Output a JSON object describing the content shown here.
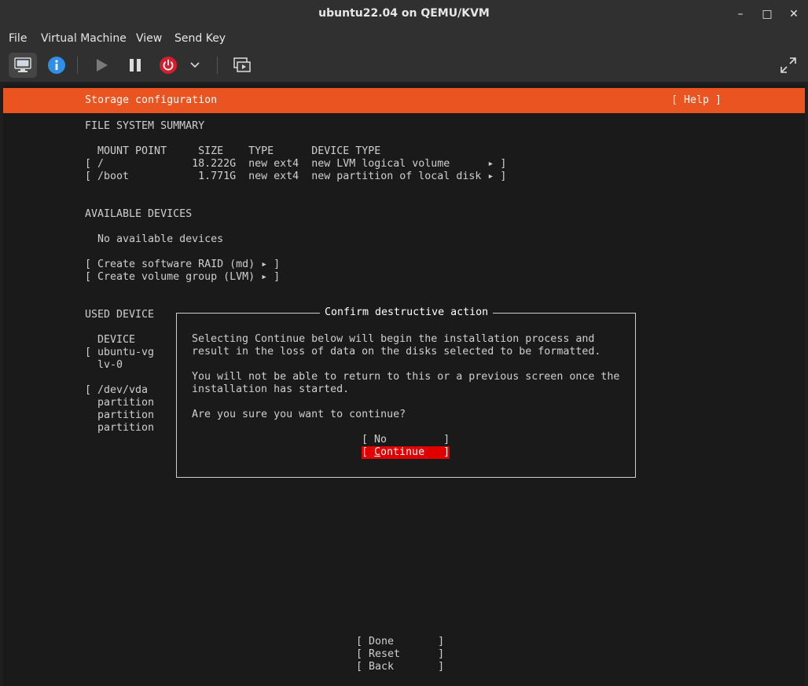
{
  "window": {
    "title": "ubuntu22.04 on QEMU/KVM",
    "minimize": "–",
    "maximize": "□",
    "close": "✕"
  },
  "menubar": {
    "items": [
      "File",
      "Virtual Machine",
      "View",
      "Send Key"
    ]
  },
  "installer": {
    "header_title": "Storage configuration",
    "help": "[ Help ]",
    "fs_summary_heading": "FILE SYSTEM SUMMARY",
    "fs_columns": "  MOUNT POINT     SIZE    TYPE      DEVICE TYPE",
    "fs_rows": [
      "[ /              18.222G  new ext4  new LVM logical volume      ▸ ]",
      "[ /boot           1.771G  new ext4  new partition of local disk ▸ ]"
    ],
    "available_heading": "AVAILABLE DEVICES",
    "no_devices": "  No available devices",
    "create_raid": "[ Create software RAID (md) ▸ ]",
    "create_vg": "[ Create volume group (LVM) ▸ ]",
    "used_heading": "USED DEVICE",
    "used_lines": [
      "  DEVICE",
      "[ ubuntu-vg",
      "  lv-0",
      "",
      "[ /dev/vda",
      "  partition",
      "  partition",
      "  partition"
    ],
    "bottom_buttons": [
      "[ Done       ]",
      "[ Reset      ]",
      "[ Back       ]"
    ]
  },
  "dialog": {
    "title": "Confirm destructive action",
    "lines": [
      "Selecting Continue below will begin the installation process and",
      "result in the loss of data on the disks selected to be formatted.",
      "",
      "You will not be able to return to this or a previous screen once the",
      "installation has started.",
      "",
      "Are you sure you want to continue?"
    ],
    "no_button": "[ No         ]",
    "continue_prefix": "[ ",
    "continue_first_letter": "C",
    "continue_rest": "ontinue   ]"
  },
  "colors": {
    "accent": "#e95420",
    "selected": "#e00000"
  },
  "icons": {
    "console": "monitor-icon",
    "details": "info-icon",
    "run": "play-icon",
    "pause": "pause-icon",
    "shutdown": "power-icon",
    "shutdown_menu": "chevron-down-icon",
    "snapshots": "snapshots-icon",
    "fullscreen": "fullscreen-icon"
  }
}
